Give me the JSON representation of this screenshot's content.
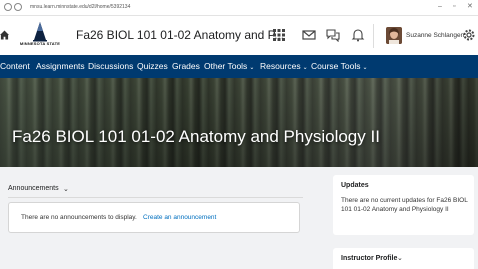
{
  "browser": {
    "url": "mnsu.learn.minnstate.edu/d2l/home/5392134"
  },
  "header": {
    "logo_text": "MINNESOTA STATE",
    "course_title": "Fa26 BIOL 101 01-02 Anatomy and P...",
    "user_name": "Suzanne Schlangen"
  },
  "nav": {
    "items": [
      {
        "label": "Content"
      },
      {
        "label": "Assignments"
      },
      {
        "label": "Discussions"
      },
      {
        "label": "Quizzes"
      },
      {
        "label": "Grades"
      },
      {
        "label": "Other Tools"
      },
      {
        "label": "Resources"
      },
      {
        "label": "Course Tools"
      }
    ]
  },
  "banner": {
    "title": "Fa26 BIOL 101 01-02 Anatomy and Physiology II"
  },
  "announcements": {
    "title": "Announcements",
    "empty_text": "There are no announcements to display.",
    "create_link": "Create an announcement"
  },
  "updates": {
    "title": "Updates",
    "text": "There are no current updates for Fa26 BIOL 101 01-02 Anatomy and Physiology II"
  },
  "instructor_profile": {
    "title": "Instructor Profile"
  },
  "colors": {
    "nav_bg": "#003a70",
    "link": "#006fbf",
    "page_bg": "#f1f2f4"
  }
}
